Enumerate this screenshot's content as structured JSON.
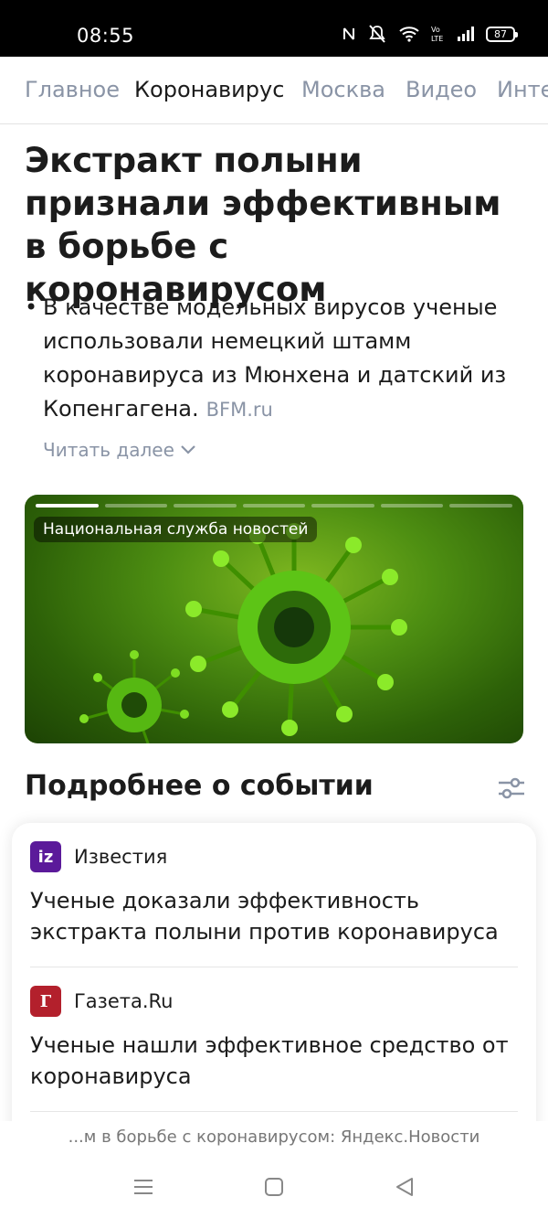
{
  "status_bar": {
    "time": "08:55",
    "battery": "87",
    "icons": [
      "nfc-icon",
      "mute-icon",
      "wifi-icon",
      "volte-icon",
      "signal-icon",
      "battery-icon"
    ]
  },
  "tabs": [
    {
      "label": "Главное",
      "active": false
    },
    {
      "label": "Коронавирус",
      "active": true
    },
    {
      "label": "Москва",
      "active": false
    },
    {
      "label": "Видео",
      "active": false
    },
    {
      "label": "Инте",
      "active": false
    }
  ],
  "article": {
    "headline": "Экстракт полыни признали эффективным в борьбе с коронавирусом",
    "summary": "В качестве модельных вирусов ученые использовали немецкий штамм коронавируса из Мюнхена и датский из Копенгагена.",
    "source": "BFM.ru",
    "read_more": "Читать далее"
  },
  "media": {
    "label": "Национальная служба новостей",
    "slides_total": 7,
    "slide_current": 1
  },
  "related": {
    "title": "Подробнее о событии",
    "items": [
      {
        "source": "Известия",
        "logo_text": "iz",
        "logo_color": "#5b1a9a",
        "title": "Ученые доказали эффективность экстракта полыни против коронавируса"
      },
      {
        "source": "Газета.Ru",
        "logo_text": "Г",
        "logo_color": "#b3202c",
        "title": "Ученые нашли эффективное средство от коронавируса"
      }
    ]
  },
  "browser": {
    "url_title": "...м в борьбе с коронавирусом: Яндекс.Новости"
  },
  "colors": {
    "muted": "#8a94a6",
    "text": "#1c1c1c"
  }
}
